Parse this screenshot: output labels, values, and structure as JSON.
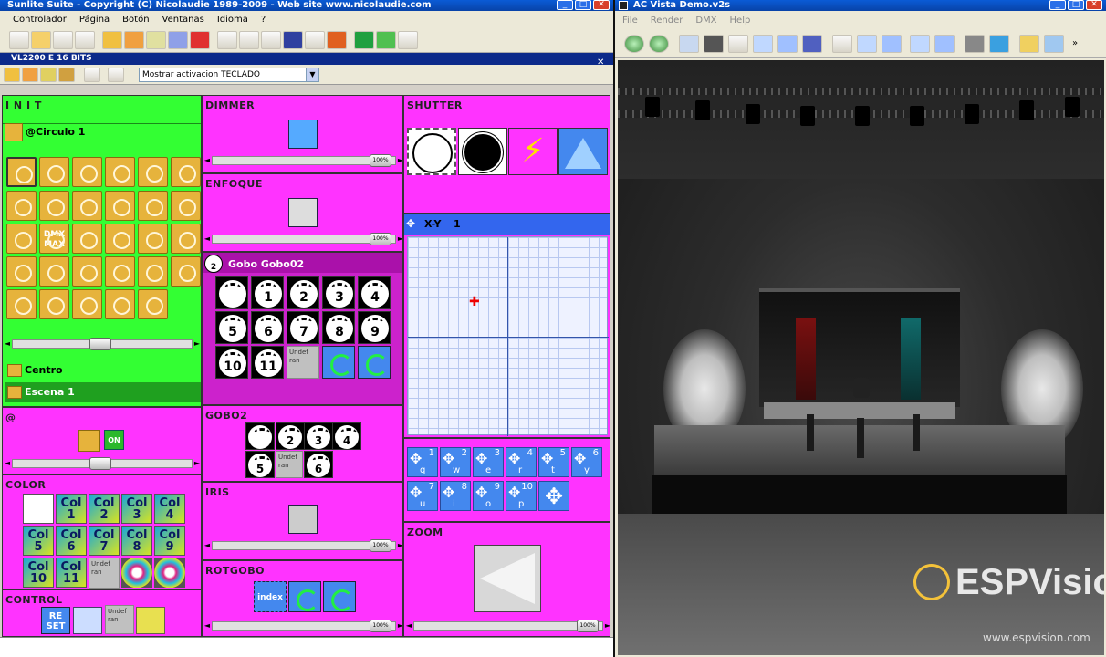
{
  "left_window": {
    "title": "Sunlite Suite - Copyright (C) Nicolaudie 1989-2009 - Web site www.nicolaudie.com",
    "menu": [
      "Controlador",
      "Página",
      "Botón",
      "Ventanas",
      "Idioma",
      "?"
    ],
    "toolbar_icons": [
      "new-icon",
      "open-icon",
      "save-icon",
      "paste-icon",
      "scene-icon",
      "switch-icon",
      "cycle-icon",
      "edit-icon",
      "color-icon",
      "page-icon",
      "sync-icon",
      "output-icon",
      "screen-icon",
      "3d-icon",
      "swap-icon",
      "dmx-icon",
      "music-icon",
      "help-icon"
    ],
    "fixture_bar": "VL2200 E 16 BITS",
    "dropdown_value": "Mostrar activacion TECLADO"
  },
  "panels": {
    "init": {
      "title": "I N I T",
      "subtitle": "@Circulo 1",
      "centro": "Centro",
      "escena": "Escena 1",
      "dmx_label": "DMX\nMAX"
    },
    "at": {
      "title": "@",
      "on_label": "ON"
    },
    "color": {
      "title": "COLOR",
      "buttons": [
        "Col\n1",
        "Col\n2",
        "Col\n3",
        "Col\n4",
        "Col\n5",
        "Col\n6",
        "Col\n7",
        "Col\n8",
        "Col\n9",
        "Col\n10",
        "Col\n11"
      ],
      "undef": "Undef ran"
    },
    "control": {
      "title": "CONTROL",
      "reset": "RE\nSET",
      "undef": "Undef ran"
    },
    "dimmer": {
      "title": "DIMMER",
      "slider_value": "100%"
    },
    "enfoque": {
      "title": "ENFOQUE",
      "slider_value": "100%"
    },
    "gobo": {
      "title": "Gobo Gobo02",
      "number": "2",
      "labels": [
        "1",
        "2",
        "3",
        "4",
        "5",
        "6",
        "7",
        "8",
        "9",
        "10",
        "11"
      ],
      "undef": "Undef ran"
    },
    "gobo2": {
      "title": "GOBO2",
      "labels": [
        "2",
        "3",
        "4",
        "5",
        "6"
      ],
      "undef": "Undef ran"
    },
    "iris": {
      "title": "IRIS",
      "slider_value": "100%"
    },
    "rotgobo": {
      "title": "ROTGOBO",
      "index_label": "index",
      "slider_value": "100%"
    },
    "shutter": {
      "title": "SHUTTER"
    },
    "xy": {
      "title": "X-Y",
      "number": "1",
      "buttons": [
        {
          "n": "1",
          "k": "q"
        },
        {
          "n": "2",
          "k": "w"
        },
        {
          "n": "3",
          "k": "e"
        },
        {
          "n": "4",
          "k": "r"
        },
        {
          "n": "5",
          "k": "t"
        },
        {
          "n": "6",
          "k": "y"
        },
        {
          "n": "7",
          "k": "u"
        },
        {
          "n": "8",
          "k": "i"
        },
        {
          "n": "9",
          "k": "o"
        },
        {
          "n": "10",
          "k": "p"
        }
      ]
    },
    "zoom": {
      "title": "ZOOM",
      "slider_value": "100%"
    }
  },
  "right_window": {
    "title": "AC Vista Demo.v2s",
    "menu": [
      "File",
      "Render",
      "DMX",
      "Help"
    ],
    "toolbar_icons": [
      "play-icon",
      "pause-icon",
      "select-icon",
      "camera-icon",
      "orbit-icon",
      "move-icon",
      "rotate-icon",
      "cube-icon",
      "zoom-icon",
      "pan-icon",
      "refresh-icon",
      "move2-icon",
      "spin-icon",
      "photo-icon",
      "globe-icon",
      "folder-icon",
      "grid-icon"
    ],
    "watermark_brand": "ESPVision",
    "watermark_url": "www.espvision.com"
  }
}
